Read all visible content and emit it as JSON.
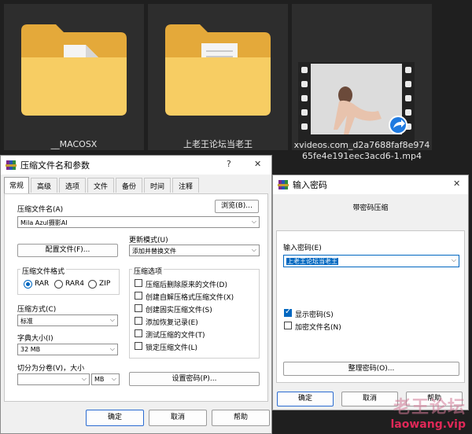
{
  "explorer": {
    "items": [
      {
        "name": "__MACOSX"
      },
      {
        "name": "上老王论坛当老王"
      },
      {
        "name_line1": "xvideos.com_d2a7688faf8e974",
        "name_line2": "65fe4e191eec3acd6-1.mp4"
      }
    ]
  },
  "archive_dialog": {
    "title": "压缩文件名和参数",
    "help_glyph": "?",
    "close_glyph": "✕",
    "tabs": [
      "常规",
      "高级",
      "选项",
      "文件",
      "备份",
      "时间",
      "注释"
    ],
    "archive_name_label": "压缩文件名(A)",
    "archive_name_value": "Mila Azul摄影AI",
    "browse_button": "浏览(B)...",
    "update_mode_label": "更新模式(U)",
    "update_mode_value": "添加并替换文件",
    "profile_button": "配置文件(F)...",
    "format_label": "压缩文件格式",
    "formats": [
      "RAR",
      "RAR4",
      "ZIP"
    ],
    "method_label": "压缩方式(C)",
    "method_value": "标准",
    "dict_label": "字典大小(I)",
    "dict_value": "32 MB",
    "split_label": "切分为分卷(V)，大小",
    "split_value": "",
    "split_unit": "MB",
    "options_label": "压缩选项",
    "options": [
      {
        "label": "压缩后删除原来的文件(D)",
        "checked": false
      },
      {
        "label": "创建自解压格式压缩文件(X)",
        "checked": false
      },
      {
        "label": "创建固实压缩文件(S)",
        "checked": false
      },
      {
        "label": "添加恢复记录(E)",
        "checked": false
      },
      {
        "label": "测试压缩的文件(T)",
        "checked": false
      },
      {
        "label": "锁定压缩文件(L)",
        "checked": false
      }
    ],
    "set_password_button": "设置密码(P)...",
    "ok": "确定",
    "cancel": "取消",
    "help": "帮助"
  },
  "password_dialog": {
    "title": "输入密码",
    "close_glyph": "✕",
    "heading": "带密码压缩",
    "password_label": "输入密码(E)",
    "password_value": "上老王论坛当老王",
    "show_password": "显示密码(S)",
    "encrypt_names": "加密文件名(N)",
    "organize_button": "整理密码(O)...",
    "ok": "确定",
    "cancel": "取消",
    "help": "帮助"
  },
  "watermark": {
    "cn": "老王论坛",
    "url": "laowang.vip"
  }
}
